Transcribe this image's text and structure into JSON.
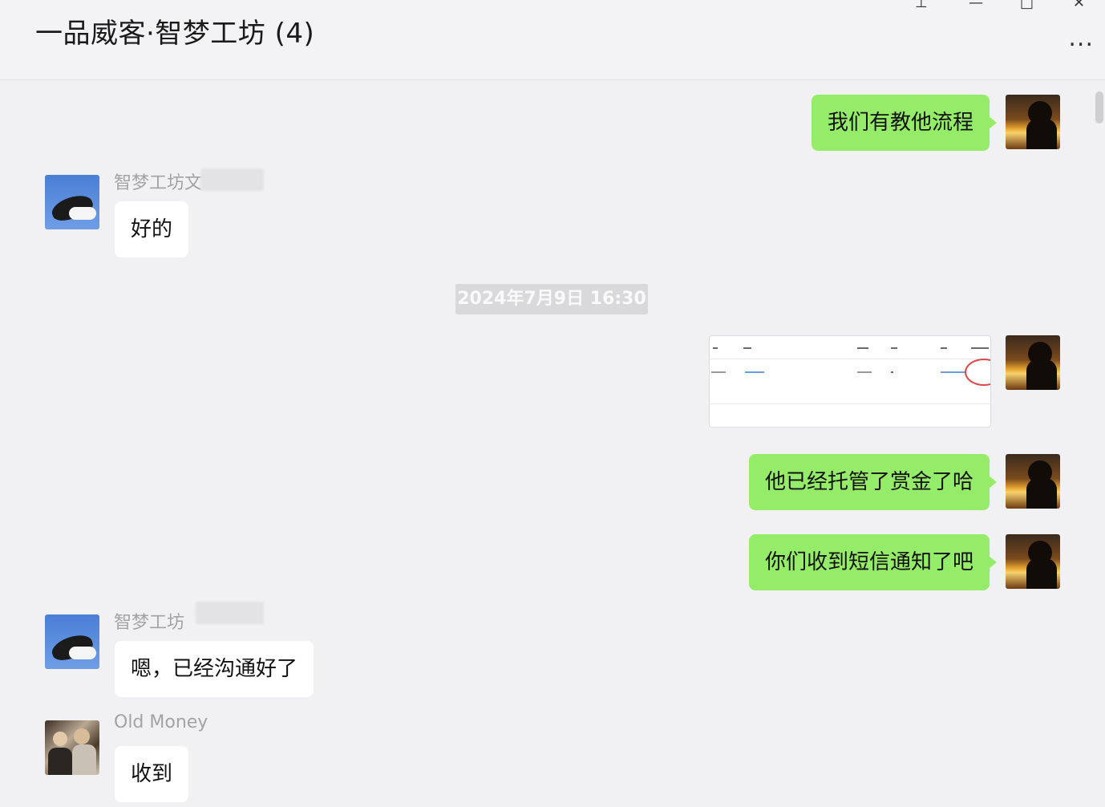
{
  "window": {
    "title": "一品威客·智梦工坊 (4)",
    "more_label": "...",
    "pin_icon": "pin-icon",
    "minimize_icon": "minimize-icon",
    "maximize_icon": "maximize-icon",
    "close_icon": "close-icon"
  },
  "messages": [
    {
      "side": "right",
      "text": "我们有教他流程"
    },
    {
      "side": "left",
      "sender": "智梦工坊文",
      "text": "好的"
    },
    {
      "timestamp": "2024年7月9日 16:30"
    },
    {
      "side": "right",
      "type": "image",
      "icon": "screenshot-thumbnail"
    },
    {
      "side": "right",
      "text": "他已经托管了赏金了哈"
    },
    {
      "side": "right",
      "text": "你们收到短信通知了吧"
    },
    {
      "side": "left",
      "sender": "智梦工坊",
      "text": "嗯，已经沟通好了"
    },
    {
      "side": "left",
      "sender": "Old Money",
      "text": "收到"
    }
  ],
  "colors": {
    "green_bubble": "#95ec69",
    "white_bubble": "#ffffff",
    "background": "#f1f1f3"
  }
}
